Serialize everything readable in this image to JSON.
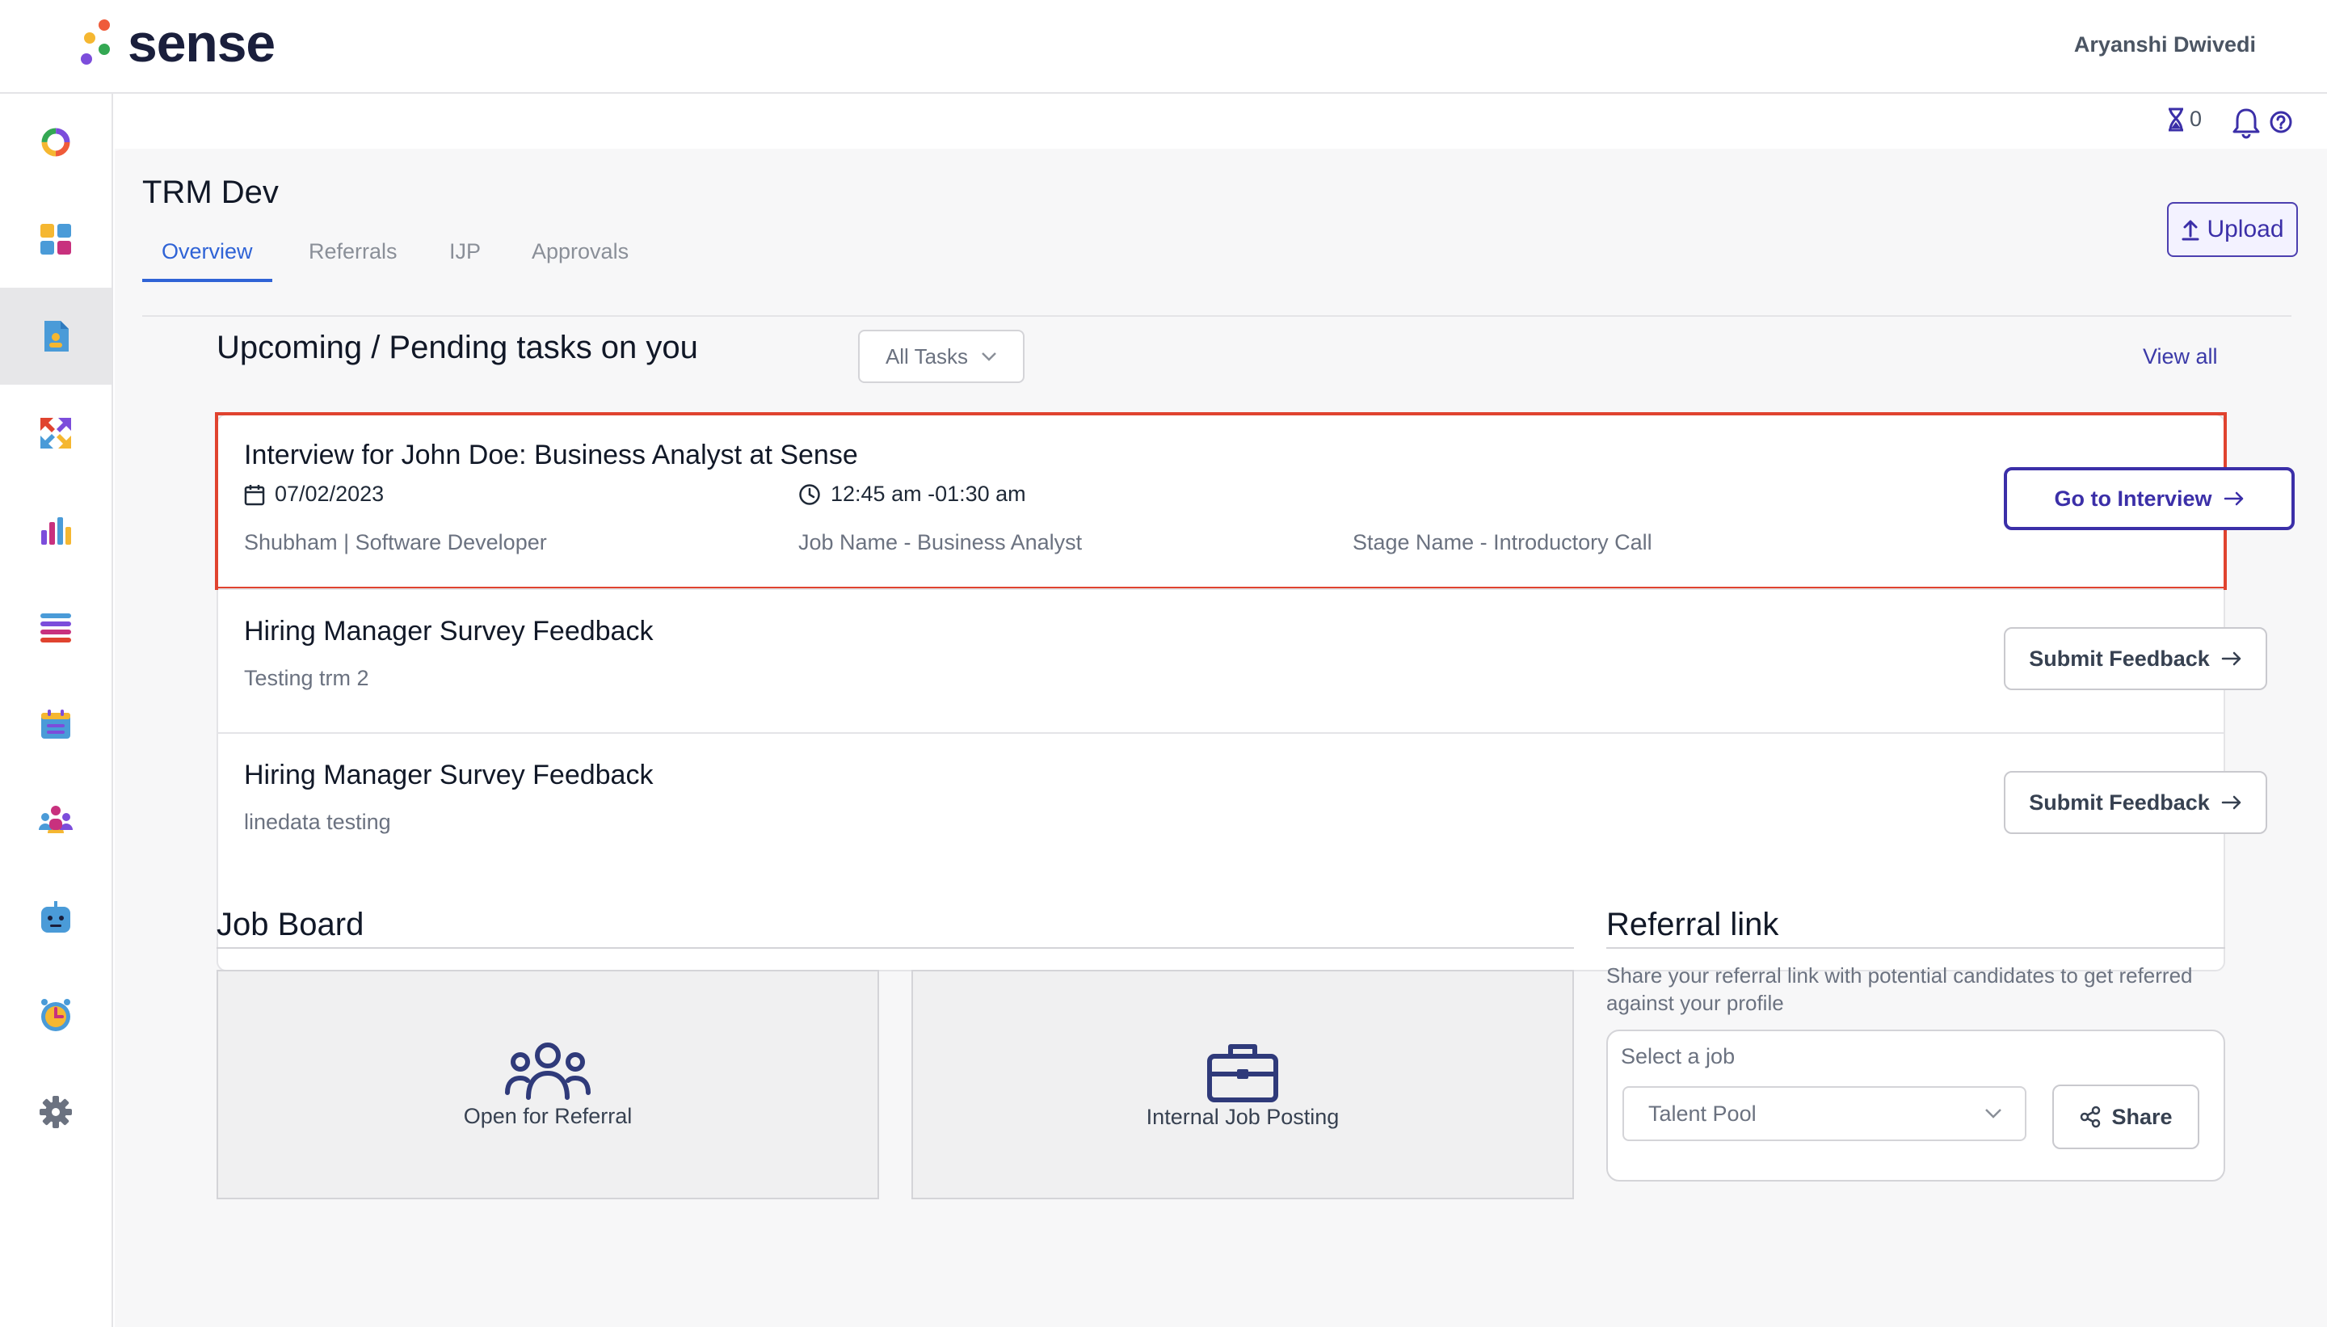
{
  "header": {
    "brand": "sense",
    "user_name": "Aryanshi Dwivedi"
  },
  "sidebar": {
    "items": [
      {
        "icon": "ring-icon"
      },
      {
        "icon": "dashboard-icon"
      },
      {
        "icon": "document-icon",
        "active": true
      },
      {
        "icon": "referral-arrows-icon"
      },
      {
        "icon": "bar-chart-icon"
      },
      {
        "icon": "list-icon"
      },
      {
        "icon": "calendar-icon"
      },
      {
        "icon": "people-icon"
      },
      {
        "icon": "bot-icon"
      },
      {
        "icon": "alarm-clock-icon"
      },
      {
        "icon": "settings-icon"
      }
    ]
  },
  "utility": {
    "hourglass_count": "0"
  },
  "page": {
    "title": "TRM Dev",
    "upload_label": "Upload",
    "tabs": [
      "Overview",
      "Referrals",
      "IJP",
      "Approvals"
    ],
    "active_tab": "Overview"
  },
  "tasks": {
    "heading": "Upcoming / Pending tasks on you",
    "filter_value": "All Tasks",
    "view_all": "View all",
    "interview": {
      "title": "Interview for John Doe: Business Analyst at Sense",
      "date": "07/02/2023",
      "time": "12:45 am -01:30 am",
      "interviewer": "Shubham | Software Developer",
      "job_name": "Job Name - Business Analyst",
      "stage_name": "Stage Name - Introductory Call",
      "action": "Go to Interview"
    },
    "surveys": [
      {
        "title": "Hiring Manager Survey Feedback",
        "subtitle": "Testing trm 2",
        "action": "Submit Feedback"
      },
      {
        "title": "Hiring Manager Survey Feedback",
        "subtitle": "linedata testing",
        "action": "Submit Feedback"
      }
    ]
  },
  "job_board": {
    "title": "Job Board",
    "cards": [
      {
        "label": "Open for Referral",
        "icon": "people-group-icon"
      },
      {
        "label": "Internal Job Posting",
        "icon": "briefcase-icon"
      }
    ]
  },
  "referral": {
    "title": "Referral link",
    "description": "Share your referral link with potential candidates to get referred against your profile",
    "select_label": "Select a job",
    "select_value": "Talent Pool",
    "share_label": "Share"
  },
  "colors": {
    "accent": "#3b2fa8",
    "tab_active": "#2f63d6",
    "highlight": "#e0432f"
  }
}
